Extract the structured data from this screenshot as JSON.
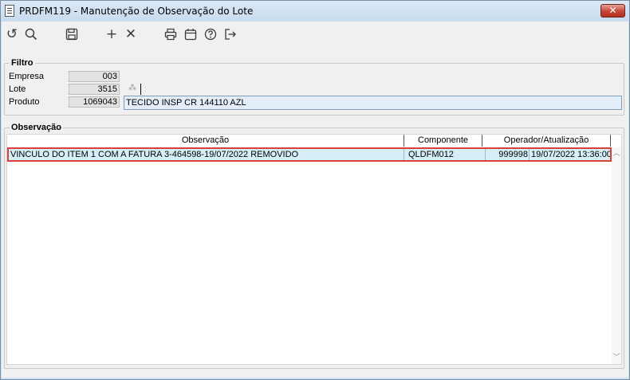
{
  "window": {
    "title": "PRDFM119 - Manutenção de Observação do Lote",
    "close_glyph": "✕"
  },
  "toolbar": {
    "buttons": [
      {
        "name": "undo-icon",
        "glyph": "↺"
      },
      {
        "name": "search-icon",
        "glyph": ""
      },
      {
        "name": "save-icon",
        "glyph": ""
      },
      {
        "name": "add-icon",
        "glyph": "+"
      },
      {
        "name": "cancel-icon",
        "glyph": "✕"
      },
      {
        "name": "print-icon",
        "glyph": ""
      },
      {
        "name": "calendar-icon",
        "glyph": ""
      },
      {
        "name": "help-icon",
        "glyph": ""
      },
      {
        "name": "exit-icon",
        "glyph": ""
      }
    ]
  },
  "filter": {
    "title": "Filtro",
    "empresa_label": "Empresa",
    "empresa_value": "003",
    "lote_label": "Lote",
    "lote_value": "3515",
    "produto_label": "Produto",
    "produto_code": "1069043",
    "produto_desc": "TECIDO INSP CR 144110 AZL"
  },
  "observacao": {
    "title": "Observação",
    "columns": [
      "Observação",
      "Componente",
      "Operador/Atualização"
    ],
    "rows": [
      {
        "observacao": "VINCULO DO ITEM 1 COM A FATURA 3-464598-19/07/2022 REMOVIDO",
        "componente": "QLDFM012",
        "operador": "999998",
        "atualizacao": "19/07/2022 13:36:00"
      }
    ]
  },
  "colors": {
    "selected_row_bg": "#d5eef8",
    "selected_row_border": "#d9423a",
    "title_bg": "#cfe0f1",
    "close_button": "#c4473a"
  }
}
